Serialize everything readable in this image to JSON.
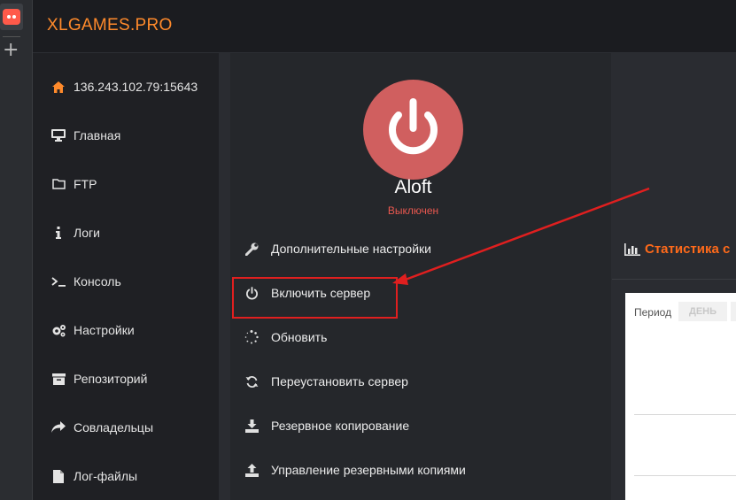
{
  "header": {
    "brand": "XLGAMES.PRO"
  },
  "sidebar": {
    "items": [
      {
        "label": "136.243.102.79:15643",
        "icon": "home-icon"
      },
      {
        "label": "Главная",
        "icon": "monitor-icon"
      },
      {
        "label": "FTP",
        "icon": "folder-icon"
      },
      {
        "label": "Логи",
        "icon": "info-icon"
      },
      {
        "label": "Консоль",
        "icon": "terminal-icon"
      },
      {
        "label": "Настройки",
        "icon": "gears-icon"
      },
      {
        "label": "Репозиторий",
        "icon": "archive-icon"
      },
      {
        "label": "Совладельцы",
        "icon": "share-icon"
      },
      {
        "label": "Лог-файлы",
        "icon": "file-icon"
      }
    ]
  },
  "server": {
    "name": "Aloft",
    "status": "Выключен",
    "status_color": "#e8574f",
    "circle_color": "#d05f5f"
  },
  "actions": [
    {
      "label": "Дополнительные настройки",
      "icon": "wrench-icon"
    },
    {
      "label": "Включить сервер",
      "icon": "power-icon",
      "highlighted": true
    },
    {
      "label": "Обновить",
      "icon": "spinner-icon"
    },
    {
      "label": "Переустановить сервер",
      "icon": "refresh-icon"
    },
    {
      "label": "Резервное копирование",
      "icon": "download-icon"
    },
    {
      "label": "Управление резервными копиями",
      "icon": "upload-icon"
    }
  ],
  "stats": {
    "title": "Статистика с",
    "period_label": "Период",
    "period_day": "ДЕНЬ"
  },
  "colors": {
    "accent": "#ff8a2b",
    "annotation": "#e01f1f"
  }
}
